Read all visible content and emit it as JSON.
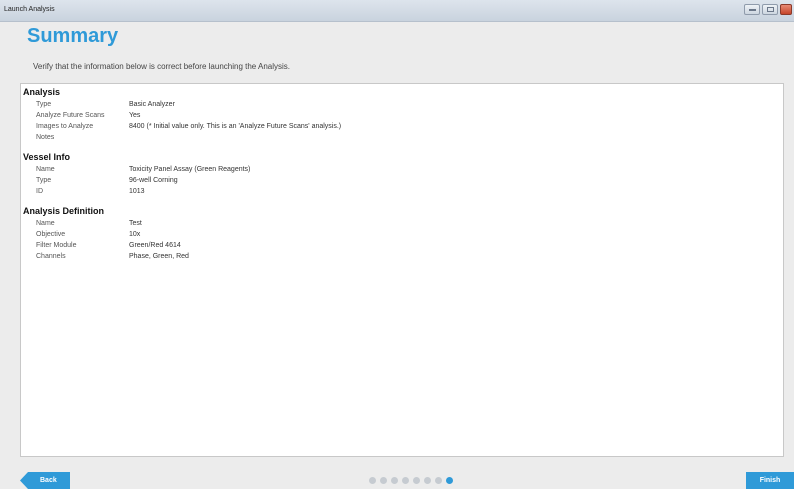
{
  "window": {
    "title": "Launch Analysis"
  },
  "header": {
    "title": "Summary",
    "subtitle": "Verify that the information below is correct before launching the Analysis."
  },
  "sections": [
    {
      "title": "Analysis",
      "rows": [
        {
          "label": "Type",
          "value": "Basic Analyzer"
        },
        {
          "label": "Analyze Future Scans",
          "value": "Yes"
        },
        {
          "label": "Images to Analyze",
          "value": "8400 (* Initial value only. This is an 'Analyze Future Scans' analysis.)"
        },
        {
          "label": "Notes",
          "value": ""
        }
      ]
    },
    {
      "title": "Vessel Info",
      "rows": [
        {
          "label": "Name",
          "value": "Toxicity Panel Assay (Green Reagents)"
        },
        {
          "label": "Type",
          "value": "96-well Corning"
        },
        {
          "label": "ID",
          "value": "1013"
        }
      ]
    },
    {
      "title": "Analysis Definition",
      "rows": [
        {
          "label": "Name",
          "value": "Test"
        },
        {
          "label": "Objective",
          "value": "10x"
        },
        {
          "label": "Filter Module",
          "value": "Green/Red 4614"
        },
        {
          "label": "Channels",
          "value": "Phase, Green, Red"
        }
      ]
    }
  ],
  "footer": {
    "back_label": "Back",
    "finish_label": "Finish",
    "steps_total": 8,
    "active_step": 8
  },
  "colors": {
    "accent": "#2f9ad8"
  }
}
